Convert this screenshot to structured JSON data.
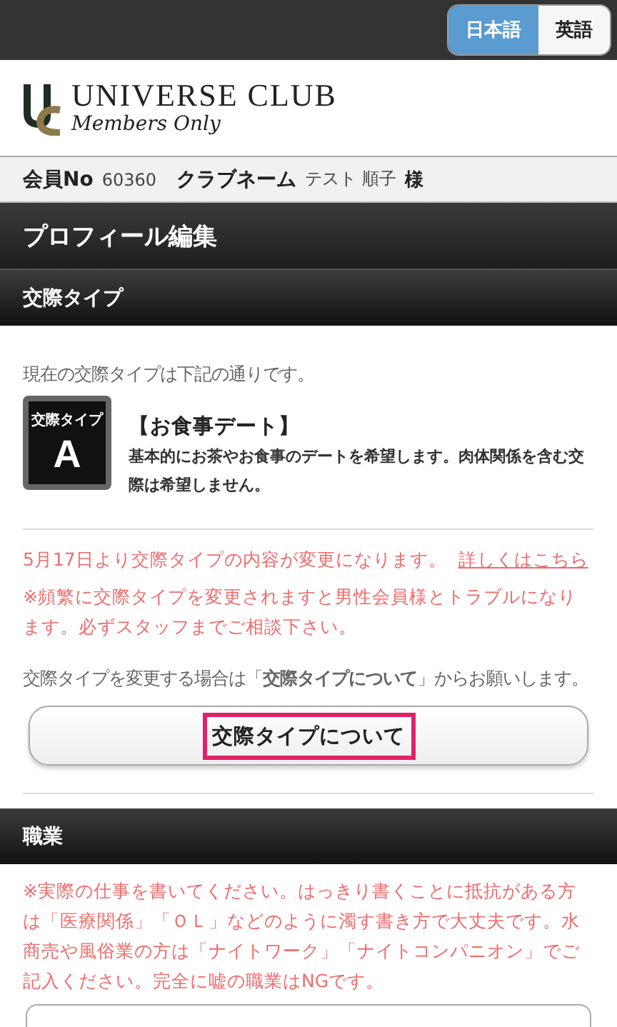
{
  "languages": [
    {
      "label": "日本語",
      "selected": true
    },
    {
      "label": "英語",
      "selected": false
    }
  ],
  "logo": {
    "title": "UNIVERSE CLUB",
    "subtitle": "Members Only"
  },
  "member": {
    "no_label": "会員No",
    "no": "60360",
    "name_label": "クラブネーム",
    "name": "テスト 順子",
    "honorific": "様"
  },
  "page_title": "プロフィール編集",
  "dating_type": {
    "heading": "交際タイプ",
    "intro": "現在の交際タイプは下記の通りです。",
    "badge_label": "交際タイプ",
    "badge_letter": "A",
    "type_name": "【お食事デート】",
    "type_description": "基本的にお茶やお食事のデートを希望します。肉体関係を含む交際は希望しません。",
    "notice": "5月17日より交際タイプの内容が変更になります。",
    "notice_link": "詳しくはこちら",
    "warning": "※頻繁に交際タイプを変更されますと男性会員様とトラブルになります。必ずスタッフまでご相談下さい。",
    "change_text": "交際タイプを変更する場合は「**交際タイプについて**」からお願いします。",
    "button": "交際タイプについて"
  },
  "occupation": {
    "heading": "職業",
    "note": "※実際の仕事を書いてください。はっきり書くことに抵抗がある方は「医療関係」「ＯＬ」などのように濁す書き方で大丈夫です。水商売や風俗業の方は「ナイトワーク」「ナイトコンパニオン」でご記入ください。完全に嘘の職業はNGです。"
  }
}
